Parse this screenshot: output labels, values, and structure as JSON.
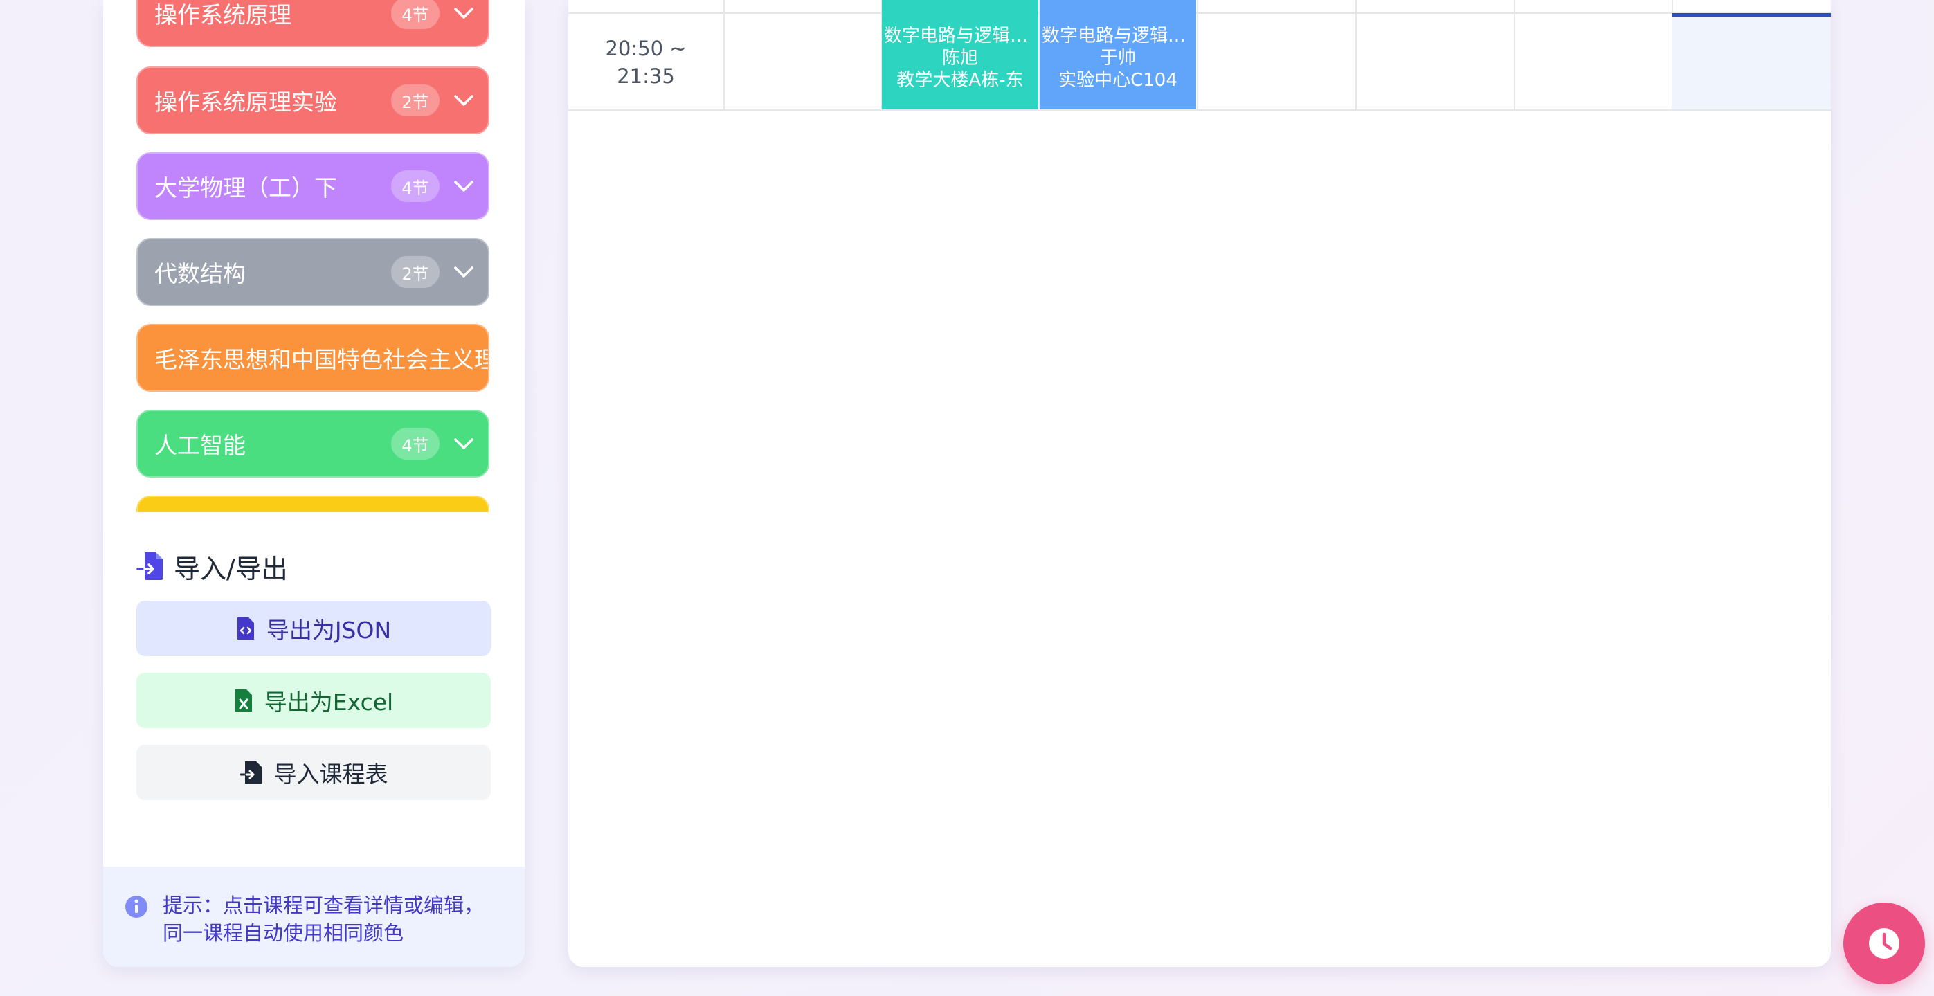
{
  "colors": {
    "os_theory": "#f87171",
    "os_lab": "#f87171",
    "physics": "#c084fc",
    "algebra": "#9ca3af",
    "mao": "#fb923c",
    "ai": "#4ade80",
    "yellow": "#facc15",
    "digital_teal": "#2dd4bf",
    "digital_blue": "#60a5fa",
    "accent_pink": "#ec4f82"
  },
  "sidebar": {
    "courses": [
      {
        "name": "操作系统原理",
        "badge": "4节"
      },
      {
        "name": "操作系统原理实验",
        "badge": "2节"
      },
      {
        "name": "大学物理（工）下",
        "badge": "4节"
      },
      {
        "name": "代数结构",
        "badge": "2节"
      },
      {
        "name": "毛泽东思想和中国特色社会主义理论体系概论",
        "badge": ""
      },
      {
        "name": "人工智能",
        "badge": "4节"
      },
      {
        "name": "",
        "badge": ""
      }
    ],
    "io": {
      "title": "导入/导出",
      "export_json": "导出为JSON",
      "export_excel": "导出为Excel",
      "import": "导入课程表"
    },
    "tip": "提示：点击课程可查看详情或编辑，同一课程自动使用相同颜色"
  },
  "timetable": {
    "row": {
      "time_start": "20:50 ~",
      "time_end": "21:35",
      "blocks": [
        {
          "title": "数字电路与逻辑设计",
          "teacher": "陈旭",
          "room": "教学大楼A栋-东"
        },
        {
          "title": "数字电路与逻辑设计",
          "teacher": "于帅",
          "room": "实验中心C104"
        }
      ]
    }
  },
  "icons": {
    "chevron": "chevron-down-icon",
    "io": "file-import-icon",
    "json": "file-code-icon",
    "excel": "file-excel-icon",
    "import": "file-import-icon",
    "info": "info-icon",
    "fab": "clock-icon"
  }
}
